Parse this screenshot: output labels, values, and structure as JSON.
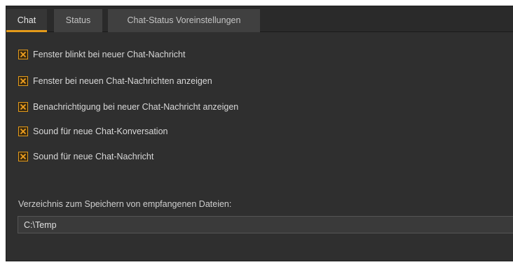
{
  "tabs": [
    {
      "label": "Chat",
      "active": true
    },
    {
      "label": "Status",
      "active": false
    },
    {
      "label": "Chat-Status Voreinstellungen",
      "active": false
    }
  ],
  "options": [
    {
      "label": "Fenster blinkt bei neuer Chat-Nachricht",
      "checked": true
    },
    {
      "label": "Fenster bei neuen Chat-Nachrichten anzeigen",
      "checked": true
    },
    {
      "label": "Benachrichtigung bei neuer Chat-Nachricht anzeigen",
      "checked": true
    },
    {
      "label": "Sound für neue Chat-Konversation",
      "checked": true
    },
    {
      "label": "Sound für neue Chat-Nachricht",
      "checked": true
    }
  ],
  "download_dir": {
    "label": "Verzeichnis zum Speichern von empfangenen Dateien:",
    "value": "C:\\Temp"
  },
  "colors": {
    "accent": "#e39a1a",
    "panel_bg": "#2f2f2f",
    "tab_bg": "#404040",
    "text": "#d8d8d8"
  },
  "icons": {
    "checkbox_mark": "x-mark-icon"
  }
}
